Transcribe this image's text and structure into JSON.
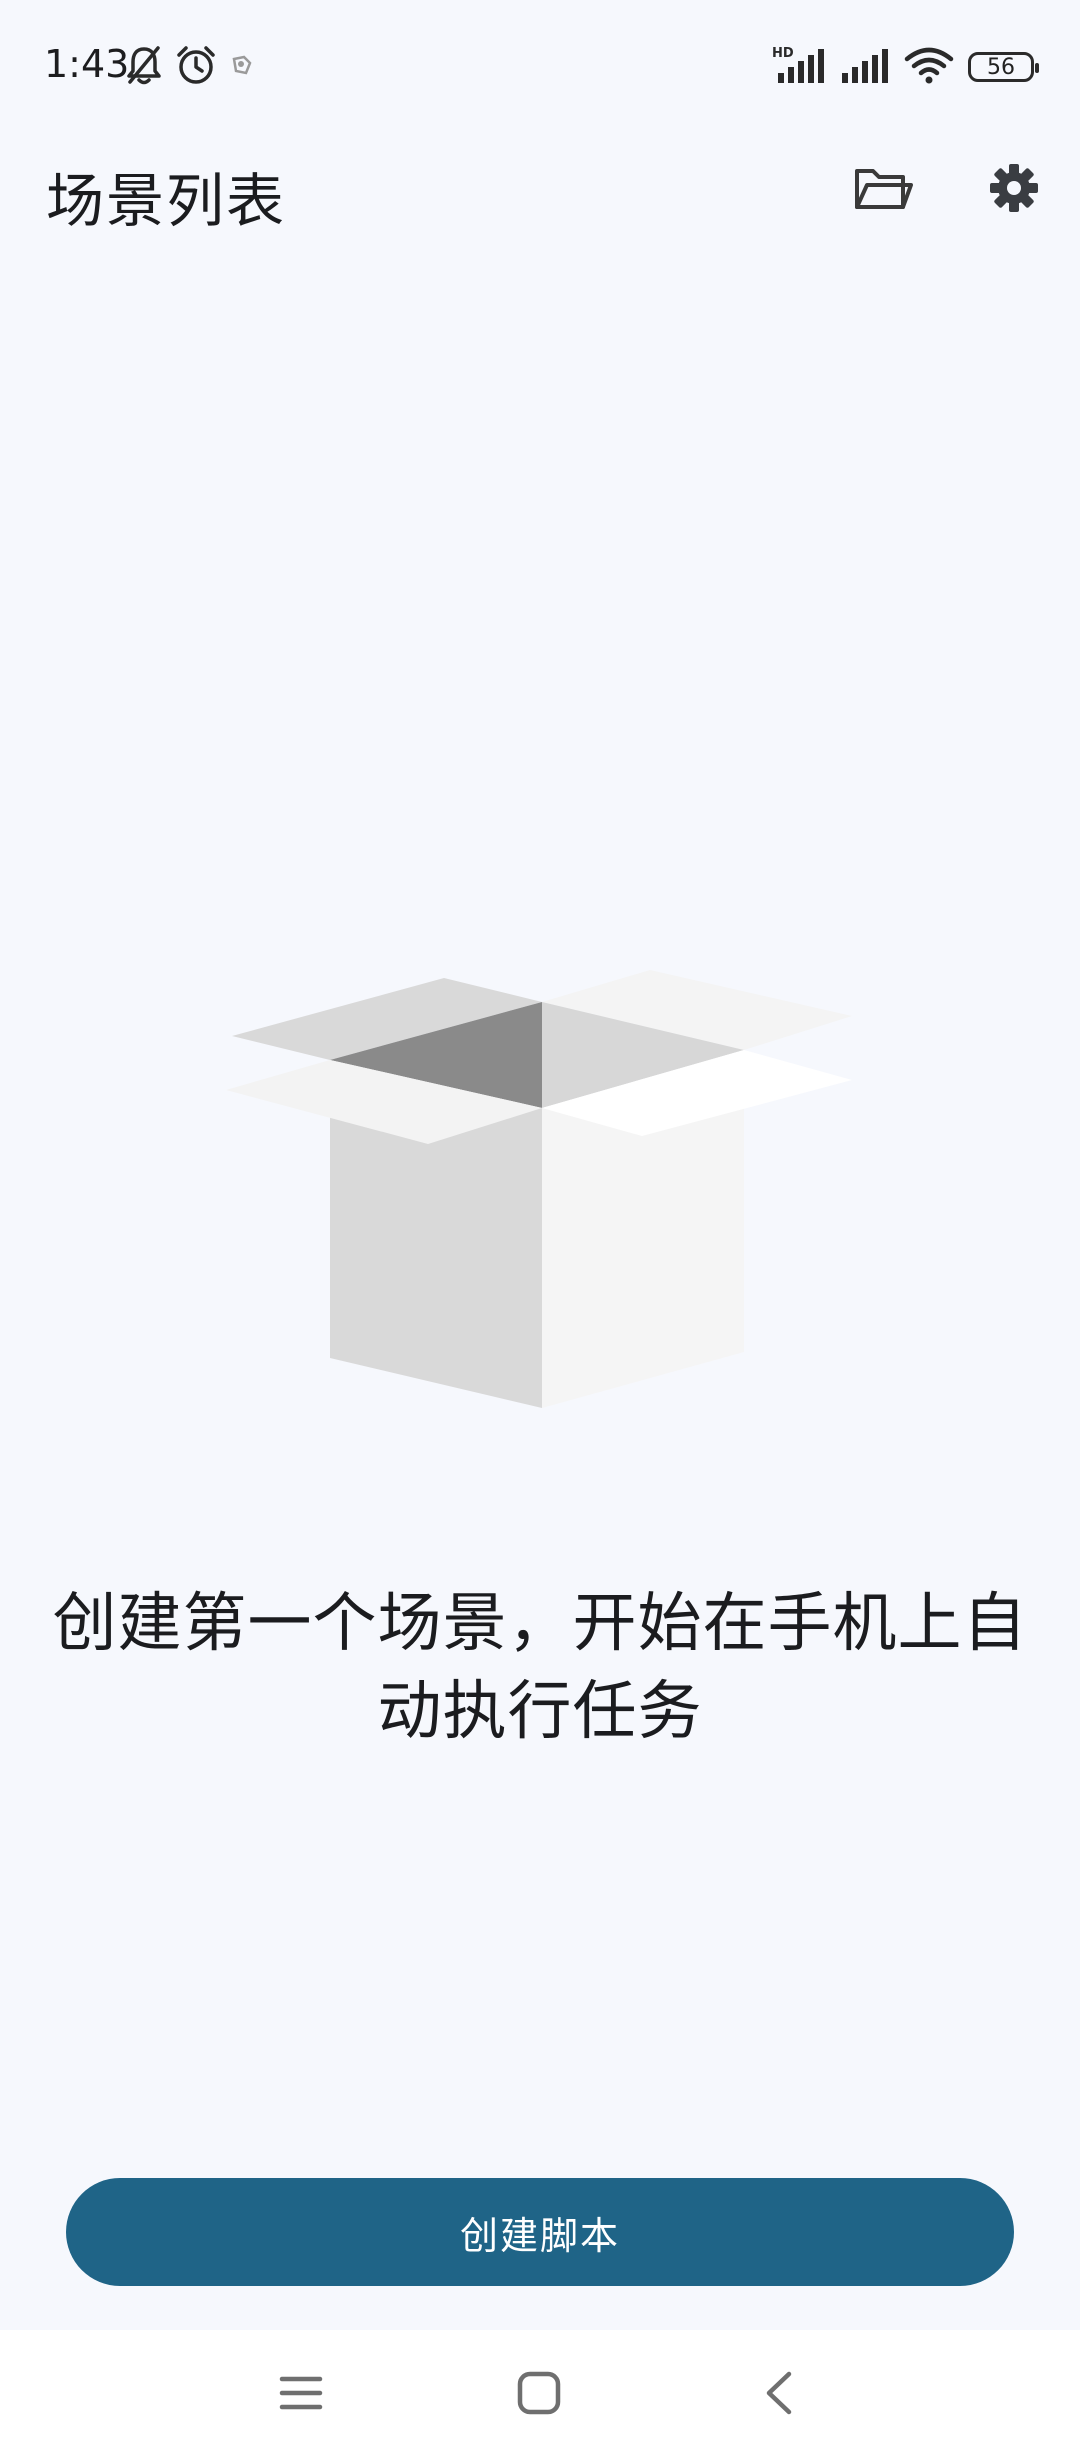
{
  "status_bar": {
    "time": "1:43",
    "battery": "56",
    "left_icons": [
      "bell-off-icon",
      "alarm-icon",
      "app-notification-icon"
    ],
    "right_icons": [
      "hd-signal-icon",
      "signal-icon",
      "wifi-icon",
      "battery-icon"
    ]
  },
  "app_bar": {
    "title": "场景列表",
    "actions": [
      "folder-open-icon",
      "settings-gear-icon"
    ]
  },
  "empty_state": {
    "illustration": "open-box-icon",
    "message": "创建第一个场景，开始在手机上自动执行任务"
  },
  "create_button": {
    "label": "创建脚本",
    "color": "#1f6487"
  },
  "nav_bar": {
    "buttons": [
      "menu-icon",
      "home-square-icon",
      "back-chevron-icon"
    ]
  },
  "colors": {
    "background": "#f6f8fd",
    "text": "#1b1c1f",
    "nav_background": "#ffffff"
  }
}
